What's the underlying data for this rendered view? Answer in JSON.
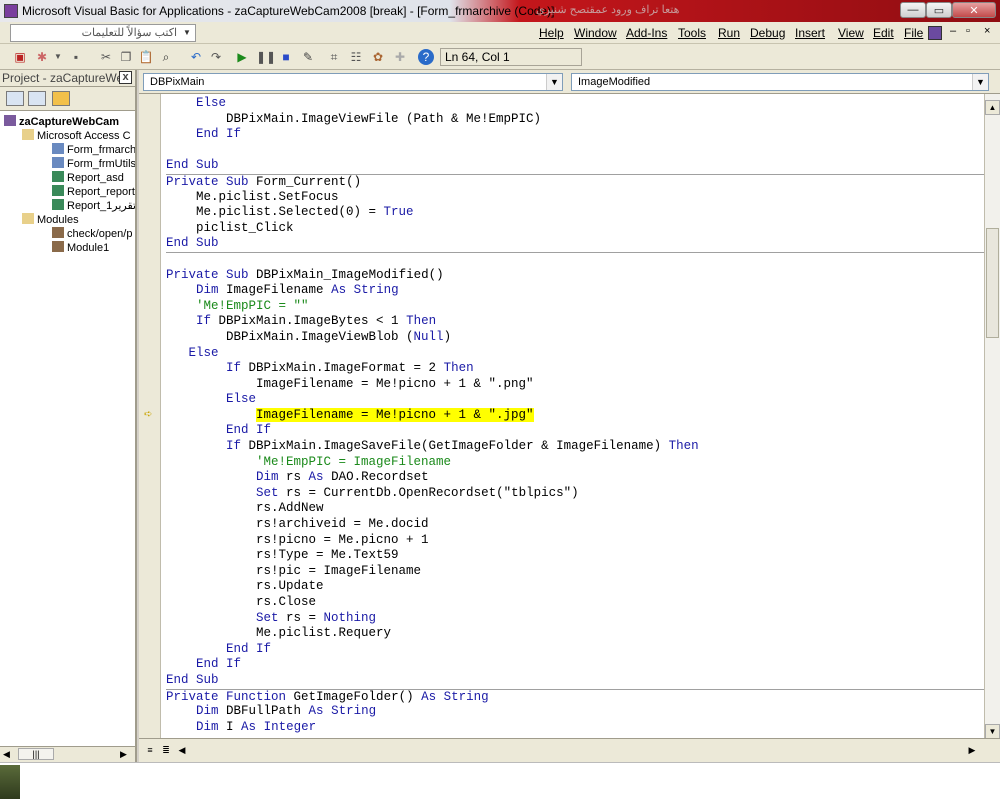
{
  "window": {
    "title": "Microsoft Visual Basic for Applications - zaCaptureWebCam2008 [break] - [Form_frmarchive (Code)]",
    "title_overlay": "هتعا تراف ورود عمقتصح شنيري",
    "min": "—",
    "max": "▭",
    "close": "✕"
  },
  "menubar": {
    "ask_placeholder": "اكتب سؤالاً للتعليمات",
    "items": [
      "Help",
      "Window",
      "Add-Ins",
      "Tools",
      "Run",
      "Debug",
      "Insert",
      "View",
      "Edit",
      "File"
    ],
    "mdi_min": "–",
    "mdi_restore": "▫",
    "mdi_close": "×"
  },
  "toolbar": {
    "position": "Ln 64, Col 1"
  },
  "project": {
    "title": "Project - zaCaptureWe",
    "close": "x",
    "tree": [
      {
        "label": "zaCaptureWebCam",
        "bold": true
      },
      {
        "label": "Microsoft Access C"
      },
      {
        "label": "Form_frmarch"
      },
      {
        "label": "Form_frmUtils"
      },
      {
        "label": "Report_asd"
      },
      {
        "label": "Report_report"
      },
      {
        "label": "Report_1تقرير"
      },
      {
        "label": "Modules"
      },
      {
        "label": "check/open/p"
      },
      {
        "label": "Module1"
      }
    ],
    "hscroll_thumb": "|||"
  },
  "editor": {
    "object_combo": "DBPixMain",
    "procedure_combo": "ImageModified",
    "current_line_index": 20,
    "lines": [
      {
        "text": "    Else",
        "sep": false
      },
      {
        "text": "        DBPixMain.ImageViewFile (Path & Me!EmpPIC)",
        "sep": false
      },
      {
        "text": "    End If",
        "sep": false
      },
      {
        "text": "",
        "sep": false
      },
      {
        "text": "End Sub",
        "sep": false
      },
      {
        "text": "Private Sub Form_Current()",
        "sep": true
      },
      {
        "text": "    Me.piclist.SetFocus",
        "sep": false
      },
      {
        "text": "    Me.piclist.Selected(0) = True",
        "sep": false
      },
      {
        "text": "    piclist_Click",
        "sep": false
      },
      {
        "text": "End Sub",
        "sep": false
      },
      {
        "text": "",
        "sep": true
      },
      {
        "text": "Private Sub DBPixMain_ImageModified()",
        "sep": false
      },
      {
        "text": "    Dim ImageFilename As String",
        "sep": false
      },
      {
        "text": "    'Me!EmpPIC = \"\"",
        "sep": false
      },
      {
        "text": "    If DBPixMain.ImageBytes < 1 Then",
        "sep": false
      },
      {
        "text": "        DBPixMain.ImageViewBlob (Null)",
        "sep": false
      },
      {
        "text": "   Else",
        "sep": false
      },
      {
        "text": "        If DBPixMain.ImageFormat = 2 Then",
        "sep": false
      },
      {
        "text": "            ImageFilename = Me!picno + 1 & \".png\"",
        "sep": false
      },
      {
        "text": "        Else",
        "sep": false
      },
      {
        "text": "            ImageFilename = Me!picno + 1 & \".jpg\"",
        "sep": false
      },
      {
        "text": "        End If",
        "sep": false
      },
      {
        "text": "        If DBPixMain.ImageSaveFile(GetImageFolder & ImageFilename) Then",
        "sep": false
      },
      {
        "text": "            'Me!EmpPIC = ImageFilename",
        "sep": false
      },
      {
        "text": "            Dim rs As DAO.Recordset",
        "sep": false
      },
      {
        "text": "            Set rs = CurrentDb.OpenRecordset(\"tblpics\")",
        "sep": false
      },
      {
        "text": "            rs.AddNew",
        "sep": false
      },
      {
        "text": "            rs!archiveid = Me.docid",
        "sep": false
      },
      {
        "text": "            rs!picno = Me.picno + 1",
        "sep": false
      },
      {
        "text": "            rs!Type = Me.Text59",
        "sep": false
      },
      {
        "text": "            rs!pic = ImageFilename",
        "sep": false
      },
      {
        "text": "            rs.Update",
        "sep": false
      },
      {
        "text": "            rs.Close",
        "sep": false
      },
      {
        "text": "            Set rs = Nothing",
        "sep": false
      },
      {
        "text": "            Me.piclist.Requery",
        "sep": false
      },
      {
        "text": "        End If",
        "sep": false
      },
      {
        "text": "    End If",
        "sep": false
      },
      {
        "text": "End Sub",
        "sep": false
      },
      {
        "text": "Private Function GetImageFolder() As String",
        "sep": true
      },
      {
        "text": "    Dim DBFullPath As String",
        "sep": false
      },
      {
        "text": "    Dim I As Integer",
        "sep": false
      }
    ]
  },
  "colors": {
    "keyword": "#1a1aa6",
    "comment": "#1b8a1b",
    "highlight": "#ffff00"
  }
}
